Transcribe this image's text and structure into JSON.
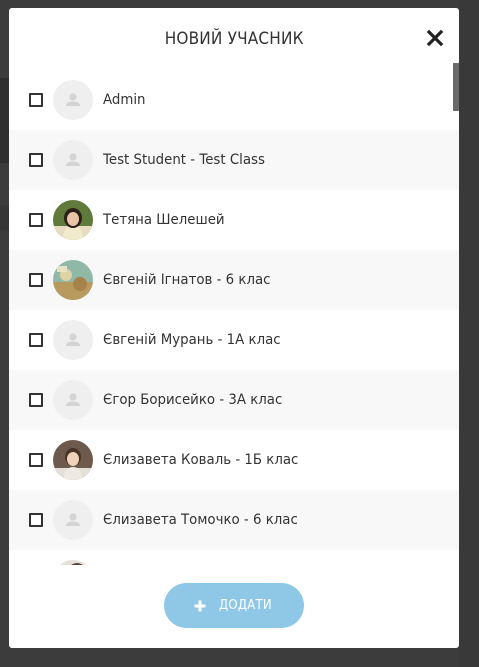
{
  "modal": {
    "title": "НОВИЙ УЧАСНИК",
    "close_icon": "close-icon",
    "add_button_label": "ДОДАТИ",
    "add_button_icon": "plus-icon",
    "accent_color": "#8ec8e6"
  },
  "members": [
    {
      "name": "Admin",
      "avatar": "default-user-icon",
      "checked": false
    },
    {
      "name": "Test Student - Test Class",
      "avatar": "default-user-icon",
      "checked": false
    },
    {
      "name": "Тетяна Шелешей",
      "avatar": "photo",
      "checked": false
    },
    {
      "name": "Євгеній Ігнатов - 6 клас",
      "avatar": "photo",
      "checked": false
    },
    {
      "name": "Євгеній Мурань - 1А клас",
      "avatar": "default-user-icon",
      "checked": false
    },
    {
      "name": "Єгор Борисейко - 3А клас",
      "avatar": "default-user-icon",
      "checked": false
    },
    {
      "name": "Єлизавета Коваль - 1Б клас",
      "avatar": "photo",
      "checked": false
    },
    {
      "name": "Єлизавета Томочко - 6 клас",
      "avatar": "default-user-icon",
      "checked": false
    }
  ]
}
